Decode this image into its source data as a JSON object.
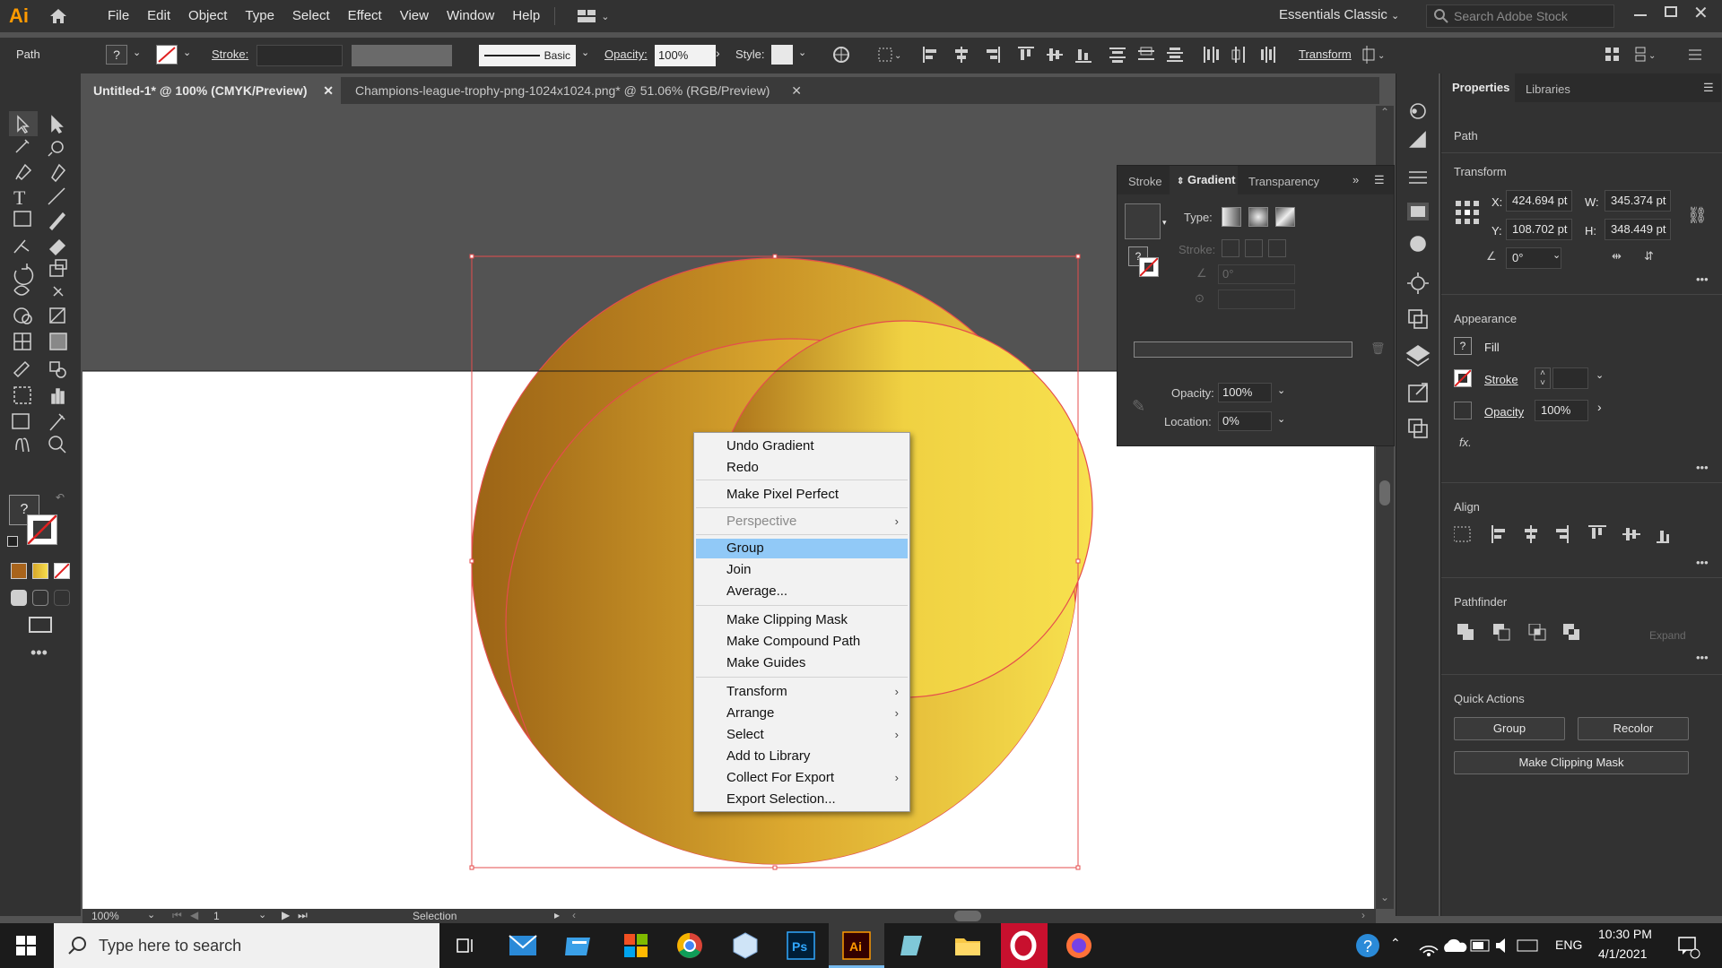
{
  "app": {
    "logo": "Ai"
  },
  "menu": [
    "File",
    "Edit",
    "Object",
    "Type",
    "Select",
    "Effect",
    "View",
    "Window",
    "Help"
  ],
  "workspace": "Essentials Classic",
  "stock_placeholder": "Search Adobe Stock",
  "control": {
    "object": "Path",
    "stroke_label": "Stroke:",
    "brush": "Basic",
    "opacity_label": "Opacity:",
    "opacity": "100%",
    "style_label": "Style:",
    "transform": "Transform"
  },
  "tabs": [
    {
      "label": "Untitled-1* @ 100% (CMYK/Preview)",
      "active": true
    },
    {
      "label": "Champions-league-trophy-png-1024x1024.png* @ 51.06% (RGB/Preview)",
      "active": false
    }
  ],
  "gradient_panel": {
    "tabs": [
      "Stroke",
      "Gradient",
      "Transparency"
    ],
    "type_label": "Type:",
    "stroke_label": "Stroke:",
    "angle": "0°",
    "opacity_label": "Opacity:",
    "opacity": "100%",
    "location_label": "Location:",
    "location": "0%"
  },
  "context_menu": {
    "items": [
      {
        "label": "Undo Gradient"
      },
      {
        "label": "Redo"
      },
      {
        "label": "Make Pixel Perfect"
      },
      {
        "label": "Perspective",
        "disabled": true,
        "sub": true
      },
      {
        "label": "Group",
        "highlight": true
      },
      {
        "label": "Join"
      },
      {
        "label": "Average..."
      },
      {
        "label": "Make Clipping Mask"
      },
      {
        "label": "Make Compound Path"
      },
      {
        "label": "Make Guides"
      },
      {
        "label": "Transform",
        "sub": true
      },
      {
        "label": "Arrange",
        "sub": true
      },
      {
        "label": "Select",
        "sub": true
      },
      {
        "label": "Add to Library"
      },
      {
        "label": "Collect For Export",
        "sub": true
      },
      {
        "label": "Export Selection..."
      }
    ]
  },
  "properties": {
    "tabs": [
      "Properties",
      "Libraries"
    ],
    "object": "Path",
    "transform_title": "Transform",
    "x_label": "X:",
    "x": "424.694 pt",
    "y_label": "Y:",
    "y": "108.702 pt",
    "w_label": "W:",
    "w": "345.374 pt",
    "h_label": "H:",
    "h": "348.449 pt",
    "rotate": "0°",
    "appearance_title": "Appearance",
    "fill": "Fill",
    "stroke": "Stroke",
    "opacity": "Opacity",
    "opacity_value": "100%",
    "fx": "fx.",
    "align_title": "Align",
    "pathfinder_title": "Pathfinder",
    "expand": "Expand",
    "quick_title": "Quick Actions",
    "group_btn": "Group",
    "recolor_btn": "Recolor",
    "clip_btn": "Make Clipping Mask"
  },
  "status": {
    "zoom": "100%",
    "artboard": "1",
    "tool": "Selection"
  },
  "taskbar": {
    "search": "Type here to search",
    "lang": "ENG",
    "time": "10:30 PM",
    "date": "4/1/2021"
  },
  "colors": {
    "accent_orange": "#ff9a00",
    "gradient_dark": "#9c6416",
    "gradient_light": "#f6de4e",
    "selection": "#e54d4d",
    "highlight": "#91c9f7"
  }
}
